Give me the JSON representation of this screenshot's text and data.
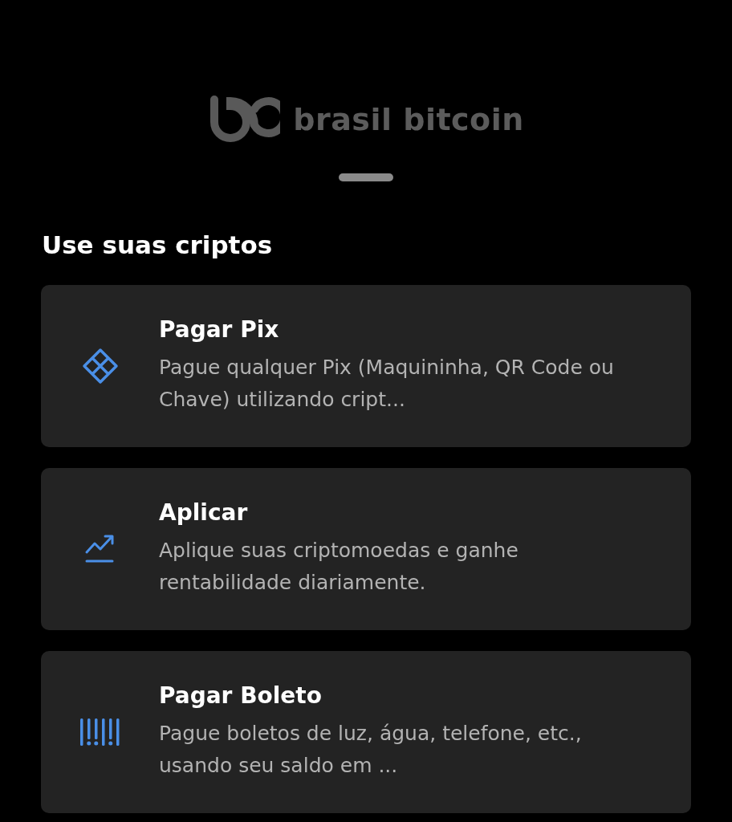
{
  "brand": {
    "name": "brasil bitcoin"
  },
  "section": {
    "title": "Use suas criptos"
  },
  "items": [
    {
      "kind": "pix",
      "title": "Pagar Pix",
      "description": "Pague qualquer Pix (Maquininha, QR Code ou Chave) utilizando cript..."
    },
    {
      "kind": "invest",
      "title": "Aplicar",
      "description": "Aplique suas criptomoedas e ganhe rentabilidade diariamente."
    },
    {
      "kind": "barcode",
      "title": "Pagar Boleto",
      "description": "Pague boletos de luz, água, telefone, etc., usando seu saldo em ..."
    }
  ]
}
